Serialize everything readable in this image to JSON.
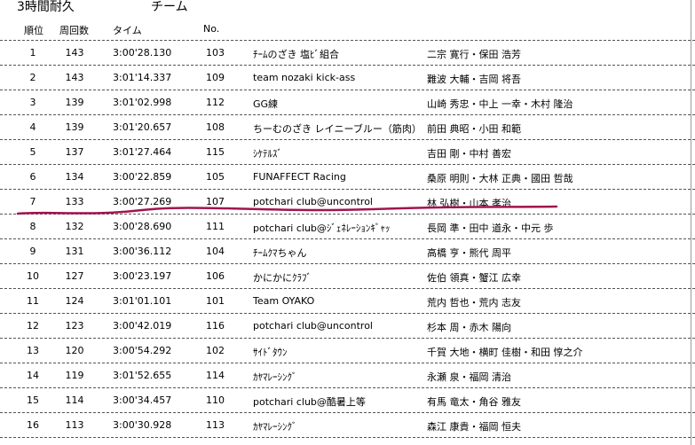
{
  "header": {
    "race_title": "3時間耐久",
    "category": "チーム",
    "columns": [
      "順位",
      "周回数",
      "タイム",
      "No."
    ]
  },
  "results": [
    {
      "rank": "1",
      "laps": "143",
      "time": "3:00'28.130",
      "no": "103",
      "team": "ﾁｰﾑのざき 塩ﾋﾞ組合",
      "drivers": "二宗 寛行・保田 浩芳"
    },
    {
      "rank": "2",
      "laps": "143",
      "time": "3:01'14.337",
      "no": "109",
      "team": "team nozaki kick-ass",
      "drivers": "難波 大輔・吉岡 将吾"
    },
    {
      "rank": "3",
      "laps": "139",
      "time": "3:01'02.998",
      "no": "112",
      "team": "GG練",
      "drivers": "山崎 秀忠・中上 一幸・木村 隆治"
    },
    {
      "rank": "4",
      "laps": "139",
      "time": "3:01'20.657",
      "no": "108",
      "team": "ちーむのざき レイニーブルー（筋肉）",
      "drivers": "前田 典昭・小田 和範"
    },
    {
      "rank": "5",
      "laps": "137",
      "time": "3:01'27.464",
      "no": "115",
      "team": "ｼｹﾃﾙｽﾞ",
      "drivers": "吉田 剛・中村 善宏"
    },
    {
      "rank": "6",
      "laps": "134",
      "time": "3:00'22.859",
      "no": "105",
      "team": "FUNAFFECT Racing",
      "drivers": "桑原 明則・大林 正典・國田 哲哉"
    },
    {
      "rank": "7",
      "laps": "133",
      "time": "3:00'27.269",
      "no": "107",
      "team": "potchari club@uncontrol",
      "drivers": "林 弘樹・山本 孝治"
    },
    {
      "rank": "8",
      "laps": "132",
      "time": "3:00'28.690",
      "no": "111",
      "team": "potchari club@ｼﾞｪﾈﾚｰｼｮﾝｷﾞｬｯ",
      "drivers": "長岡 準・田中 道永・中元 歩"
    },
    {
      "rank": "9",
      "laps": "131",
      "time": "3:00'36.112",
      "no": "104",
      "team": "ﾁｰﾑｸﾏちゃん",
      "drivers": "高橋 亨・熊代 周平"
    },
    {
      "rank": "10",
      "laps": "127",
      "time": "3:00'23.197",
      "no": "106",
      "team": "かにかにｸﾗﾌﾞ",
      "drivers": "佐伯 領真・蟹江 広幸"
    },
    {
      "rank": "11",
      "laps": "124",
      "time": "3:01'01.101",
      "no": "101",
      "team": "Team OYAKO",
      "drivers": "荒内 哲也・荒内 志友"
    },
    {
      "rank": "12",
      "laps": "123",
      "time": "3:00'42.019",
      "no": "116",
      "team": "potchari club@uncontrol",
      "drivers": "杉本 周・赤木 陽向"
    },
    {
      "rank": "13",
      "laps": "120",
      "time": "3:00'54.292",
      "no": "102",
      "team": "ｻｲﾄﾞﾀｳﾝ",
      "drivers": "千賀 大地・横町 佳樹・和田 惇之介"
    },
    {
      "rank": "14",
      "laps": "119",
      "time": "3:01'52.655",
      "no": "114",
      "team": "ｶﾔﾏﾚｰｼﾝｸﾞ",
      "drivers": "永瀬 泉・福岡 清治"
    },
    {
      "rank": "15",
      "laps": "114",
      "time": "3:00'34.457",
      "no": "110",
      "team": "potchari club@酷暑上等",
      "drivers": "有馬 竜太・角谷 雅友"
    },
    {
      "rank": "16",
      "laps": "113",
      "time": "3:00'30.928",
      "no": "113",
      "team": "ｶﾔﾏﾚｰｼﾝｸﾞ",
      "drivers": "森江 康貴・福岡 恒夫"
    }
  ],
  "highlight": {
    "rank": "7",
    "color": "#a0144f"
  }
}
